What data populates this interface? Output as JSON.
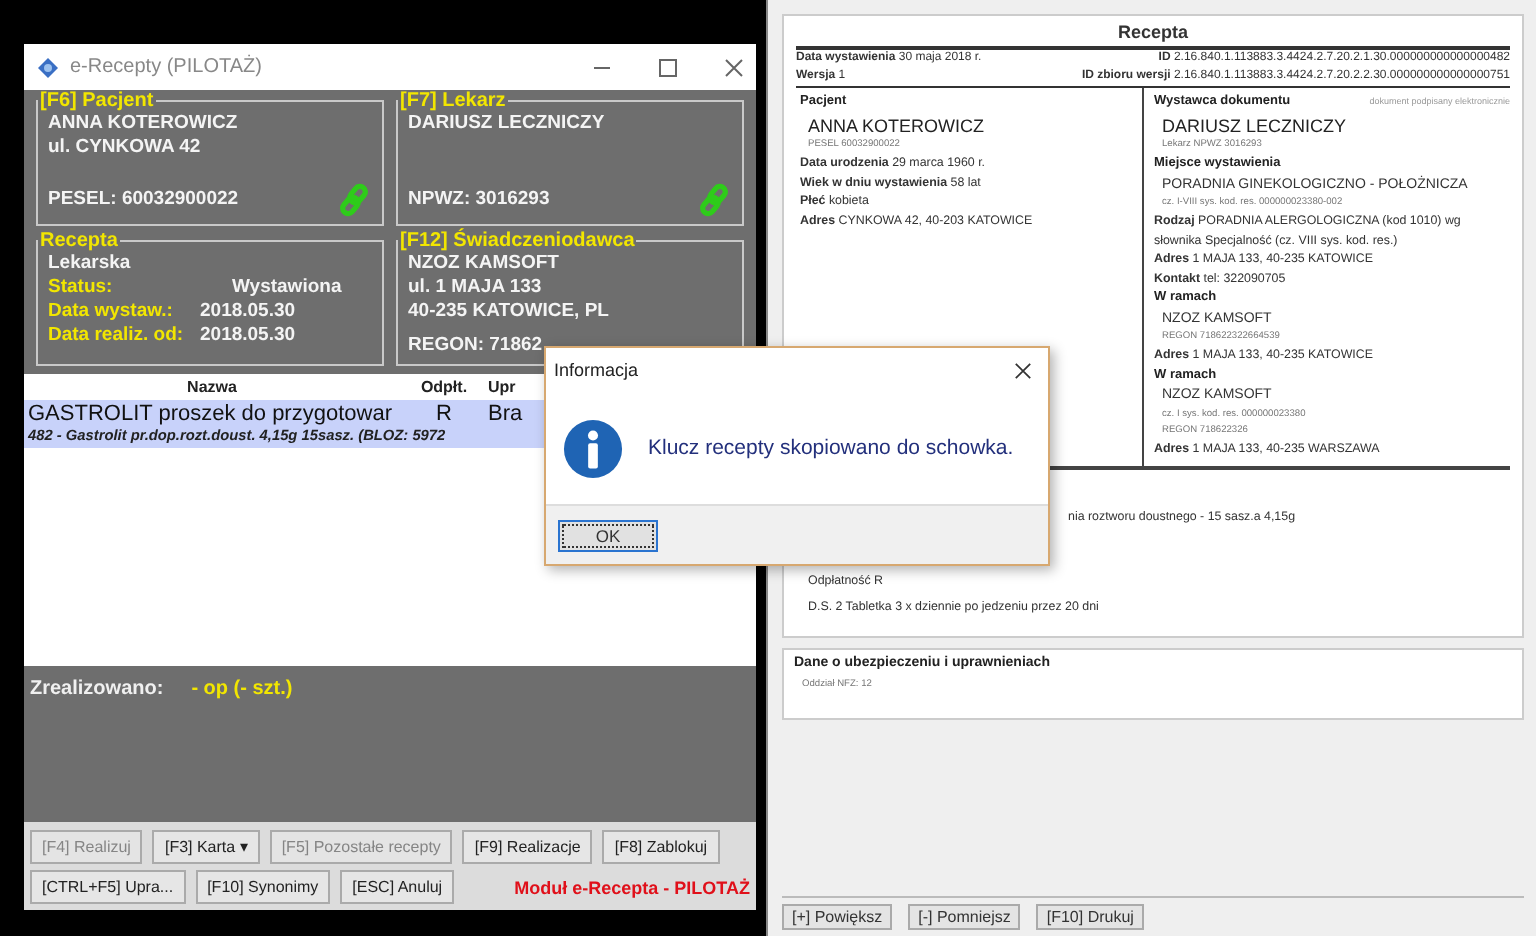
{
  "app_window": {
    "title": "e-Recepty (PILOTAŻ)",
    "patient": {
      "legend": "[F6] Pacjent",
      "lines": [
        "ANNA KOTEROWICZ",
        "ul. CYNKOWA 42"
      ],
      "id_line": "PESEL: 60032900022",
      "linked": true
    },
    "doctor": {
      "legend": "[F7] Lekarz",
      "lines": [
        "DARIUSZ LECZNICZY"
      ],
      "id_line": "NPWZ: 3016293",
      "linked": true
    },
    "prescription": {
      "legend": "Recepta",
      "type": "Lekarska",
      "fields": [
        {
          "label": "Status:",
          "value": "Wystawiona"
        },
        {
          "label": "Data wystaw.:",
          "value": "2018.05.30"
        },
        {
          "label": "Data realiz. od:",
          "value": "2018.05.30"
        }
      ]
    },
    "provider": {
      "legend": "[F12] Świadczeniodawca",
      "lines": [
        "NZOZ KAMSOFT",
        "ul. 1 MAJA 133",
        "40-235 KATOWICE, PL"
      ],
      "id_line": "REGON: 71862"
    },
    "table": {
      "columns": [
        "Nazwa",
        "Odpłt.",
        "Upr"
      ],
      "rows": [
        {
          "cells": [
            "GASTROLIT proszek do przygotowar",
            "R",
            "Bra"
          ],
          "detail": "482 - Gastrolit pr.dop.rozt.doust. 4,15g 15sasz. (BLOZ: 5972",
          "selected": true
        }
      ]
    },
    "realized": {
      "label": "Zrealizowano:",
      "value": "- op (- szt.)"
    },
    "button_rows": [
      [
        {
          "label": "[F4] Realizuj",
          "disabled": true
        },
        {
          "label": "[F3] Karta ▾",
          "disabled": false
        },
        {
          "label": "[F5] Pozostałe recepty",
          "disabled": true
        },
        {
          "label": "[F9] Realizacje",
          "disabled": false
        },
        {
          "label": "[F8] Zablokuj",
          "disabled": false
        }
      ],
      [
        {
          "label": "[CTRL+F5] Upra...",
          "disabled": false
        },
        {
          "label": "[F10] Synonimy",
          "disabled": false
        },
        {
          "label": "[ESC] Anuluj",
          "disabled": false
        }
      ]
    ],
    "module_label": "Moduł e-Recepta - PILOTAŻ"
  },
  "preview": {
    "title": "Recepta",
    "meta": [
      {
        "left": "**Data wystawienia** 30 maja 2018 r.",
        "right": "**ID** 2.16.840.1.113883.3.4424.2.7.20.2.1.30.000000000000000482"
      },
      {
        "left": "**Wersja** 1",
        "right": "**ID zbioru wersji** 2.16.840.1.113883.3.4424.2.7.20.2.2.30.000000000000000751"
      }
    ],
    "patient_col": [
      {
        "kind": "head",
        "text": "Pacjent"
      },
      {
        "kind": "name",
        "text": "ANNA KOTEROWICZ"
      },
      {
        "kind": "small",
        "text": "PESEL 60032900022"
      },
      {
        "kind": "text",
        "text": "**Data urodzenia** 29 marca 1960 r."
      },
      {
        "kind": "text",
        "text": "**Wiek w dniu wystawienia** 58 lat"
      },
      {
        "kind": "text",
        "text": "**Płeć** kobieta"
      },
      {
        "kind": "text",
        "text": "**Adres** CYNKOWA 42, 40-203 KATOWICE"
      }
    ],
    "issuer_note": "dokument podpisany elektronicznie",
    "issuer_col": [
      {
        "kind": "head",
        "text": "Wystawca dokumentu"
      },
      {
        "kind": "name",
        "text": "DARIUSZ LECZNICZY"
      },
      {
        "kind": "small",
        "text": "Lekarz NPWZ 3016293"
      },
      {
        "kind": "head",
        "text": "Miejsce wystawienia"
      },
      {
        "kind": "sub",
        "text": "PORADNIA GINEKOLOGICZNO - POŁOŻNICZA"
      },
      {
        "kind": "small",
        "text": "cz. I-VIII sys. kod. res. 000000023380-002"
      },
      {
        "kind": "text",
        "text": "**Rodzaj** PORADNIA ALERGOLOGICZNA (kod 1010) wg słownika Specjalność (cz. VIII sys. kod. res.)"
      },
      {
        "kind": "text",
        "text": "**Adres** 1 MAJA 133, 40-235 KATOWICE"
      },
      {
        "kind": "text",
        "text": "**Kontakt** tel: 322090705"
      },
      {
        "kind": "head",
        "text": "W ramach"
      },
      {
        "kind": "sub",
        "text": "NZOZ KAMSOFT"
      },
      {
        "kind": "small",
        "text": "REGON 718622322664539"
      },
      {
        "kind": "text",
        "text": "**Adres** 1 MAJA 133, 40-235 KATOWICE"
      },
      {
        "kind": "head",
        "text": "W ramach"
      },
      {
        "kind": "sub",
        "text": "NZOZ KAMSOFT"
      },
      {
        "kind": "small",
        "text": "cz. I sys. kod. res. 000000023380"
      },
      {
        "kind": "small",
        "text": "REGON 718622326"
      },
      {
        "kind": "text",
        "text": "**Adres** 1 MAJA 133, 40-235 WARSZAWA"
      }
    ],
    "medication_cut": "nia roztworu doustnego - 15 sasz.a 4,15g",
    "medication_lines": [
      "Odpłatność R",
      "D.S. 2 Tabletka 3 x dziennie po jedzeniu przez 20 dni"
    ],
    "insurance": {
      "title": "Dane o ubezpieczeniu i uprawnieniach",
      "lines": [
        "Oddział NFZ: 12"
      ]
    },
    "buttons": [
      "[+] Powiększ",
      "[-] Pomniejsz",
      "[F10] Drukuj"
    ]
  },
  "dialog": {
    "title": "Informacja",
    "message": "Klucz recepty skopiowano do schowka.",
    "buttons": [
      {
        "label": "OK",
        "focused": true
      }
    ]
  }
}
